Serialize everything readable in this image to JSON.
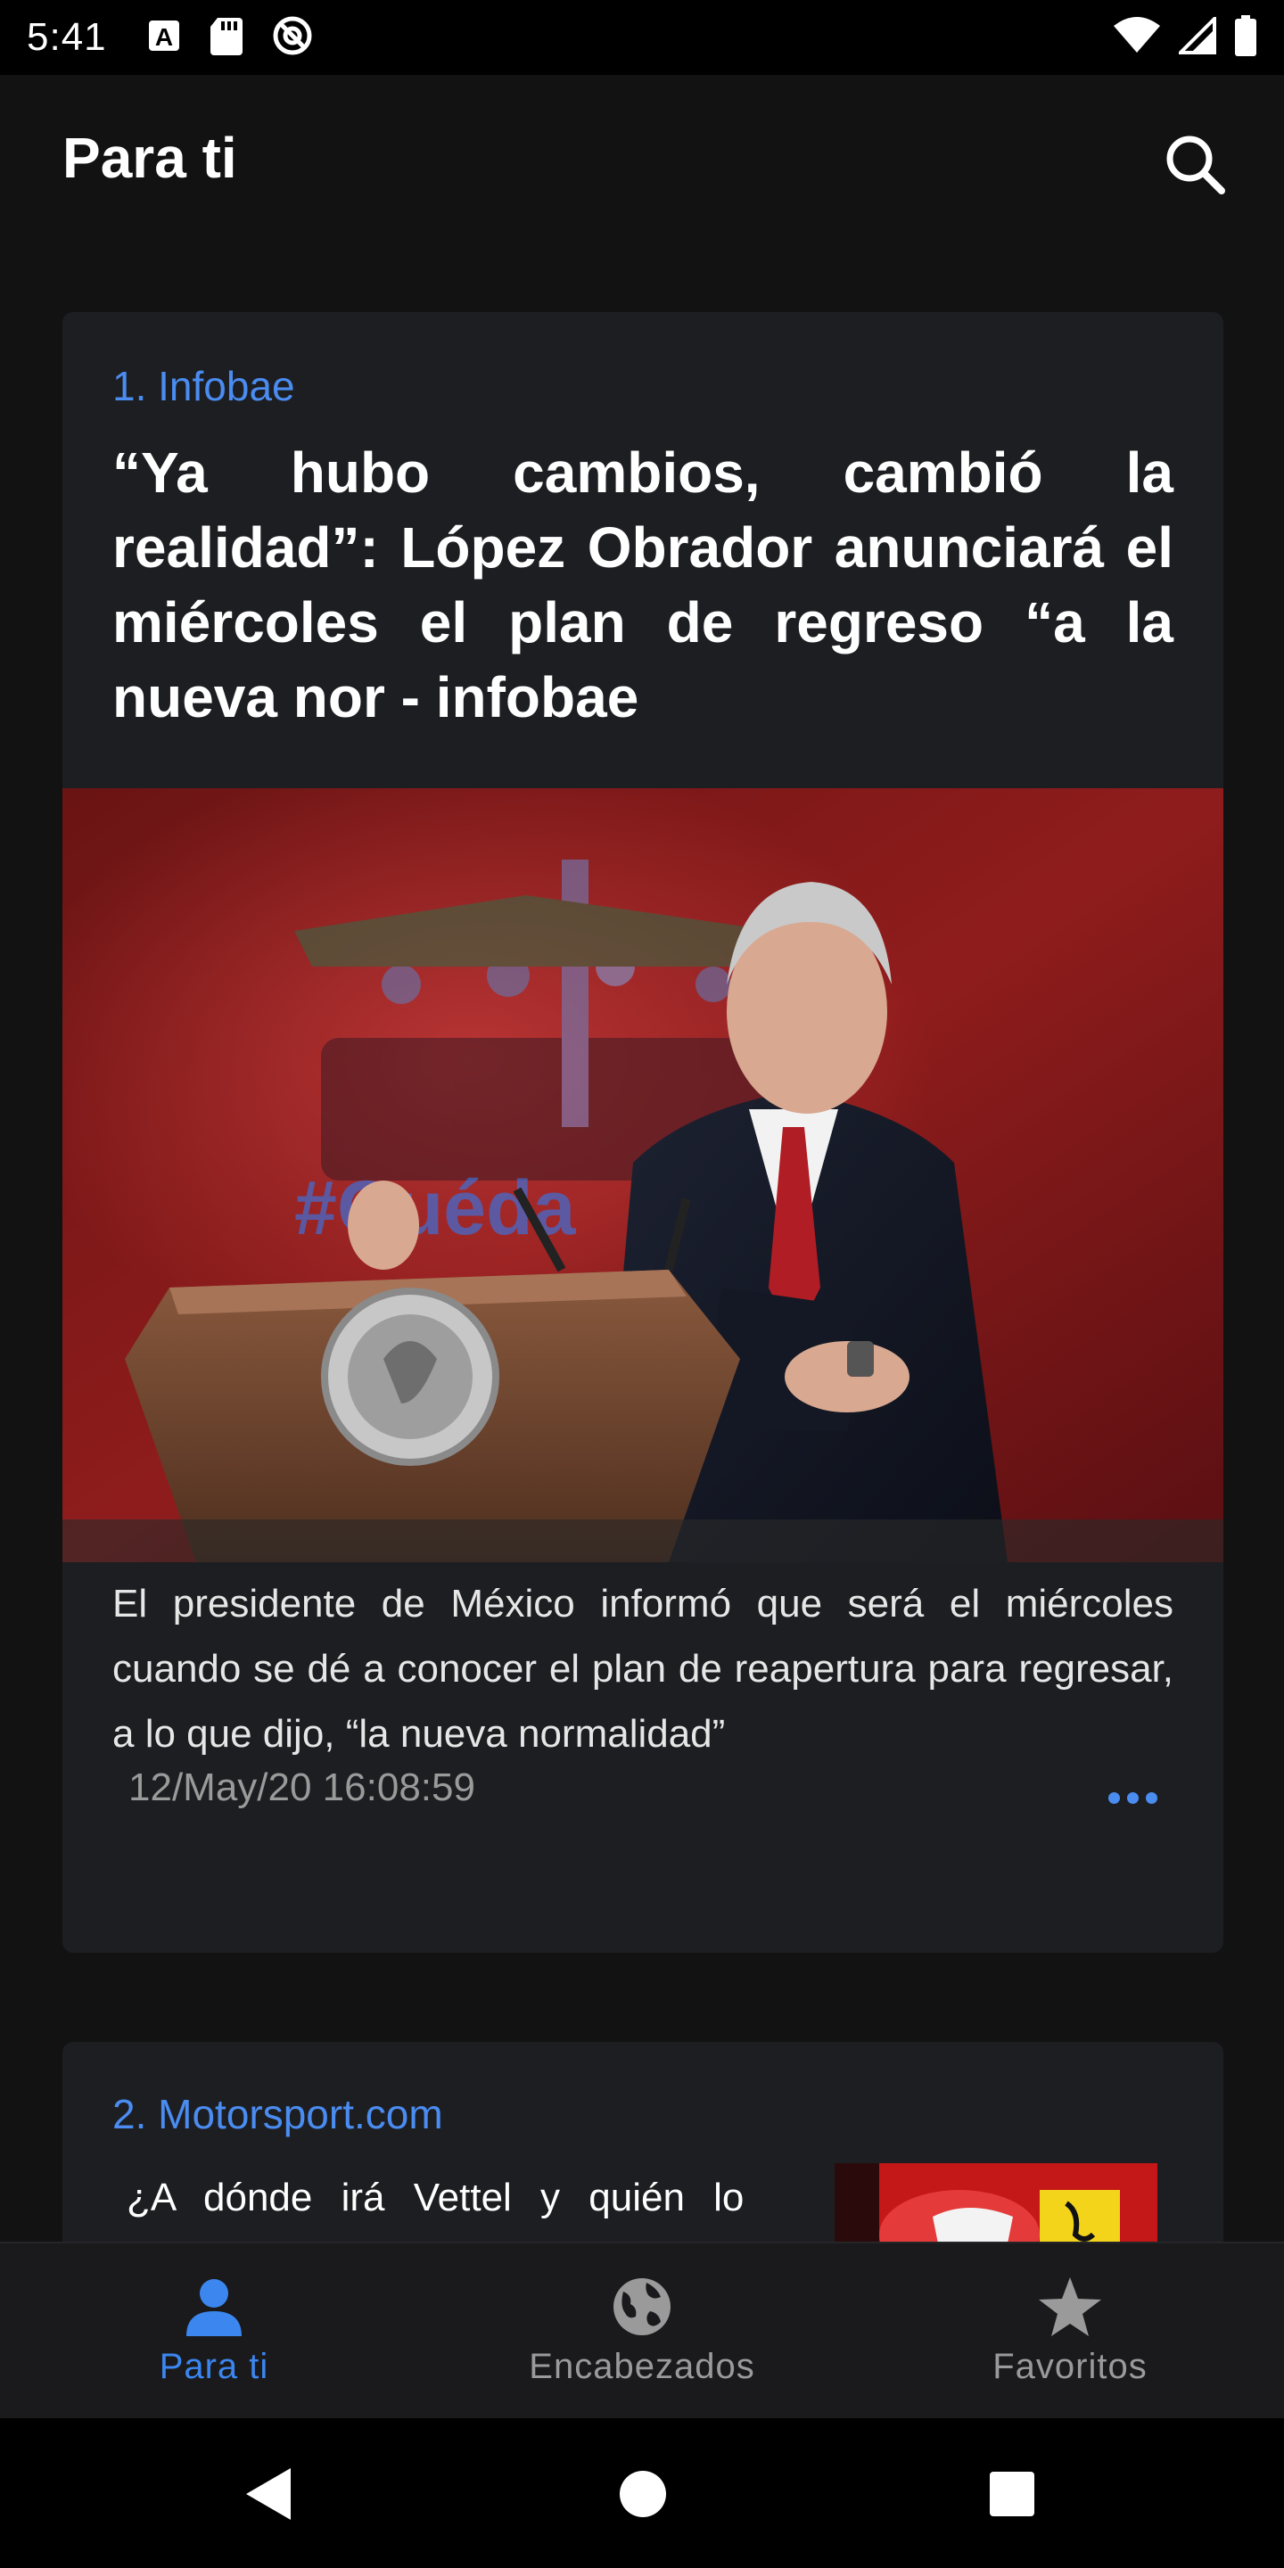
{
  "status_bar": {
    "time": "5:41",
    "icons_left": [
      "font-a-icon",
      "sd-card-icon",
      "no-sync-icon"
    ],
    "icons_right": [
      "wifi-icon",
      "cell-signal-icon",
      "battery-icon"
    ]
  },
  "app_bar": {
    "title": "Para ti",
    "search_icon": "search-icon"
  },
  "articles": [
    {
      "source": "1. Infobae",
      "headline": "“Ya hubo cambios, cambió la realidad”: López Obrador anunciará el miércoles el plan de regreso “a la nueva nor - infobae",
      "summary": "El presidente de México informó que será el miércoles cuando se dé a conocer el plan de reapertura para regresar, a lo que dijo, “la nueva normalidad”",
      "timestamp": "12/May/20 16:08:59"
    },
    {
      "source": "2. Motorsport.com",
      "headline": "¿A dónde irá Vettel y quién lo"
    }
  ],
  "bottom_nav": {
    "items": [
      {
        "label": "Para ti",
        "icon": "person-icon",
        "active": true
      },
      {
        "label": "Encabezados",
        "icon": "globe-icon",
        "active": false
      },
      {
        "label": "Favoritos",
        "icon": "star-icon",
        "active": false
      }
    ]
  },
  "colors": {
    "background": "#121212",
    "card": "#1d1e22",
    "accent": "#4a8cf0",
    "muted": "#9a9a9a"
  }
}
